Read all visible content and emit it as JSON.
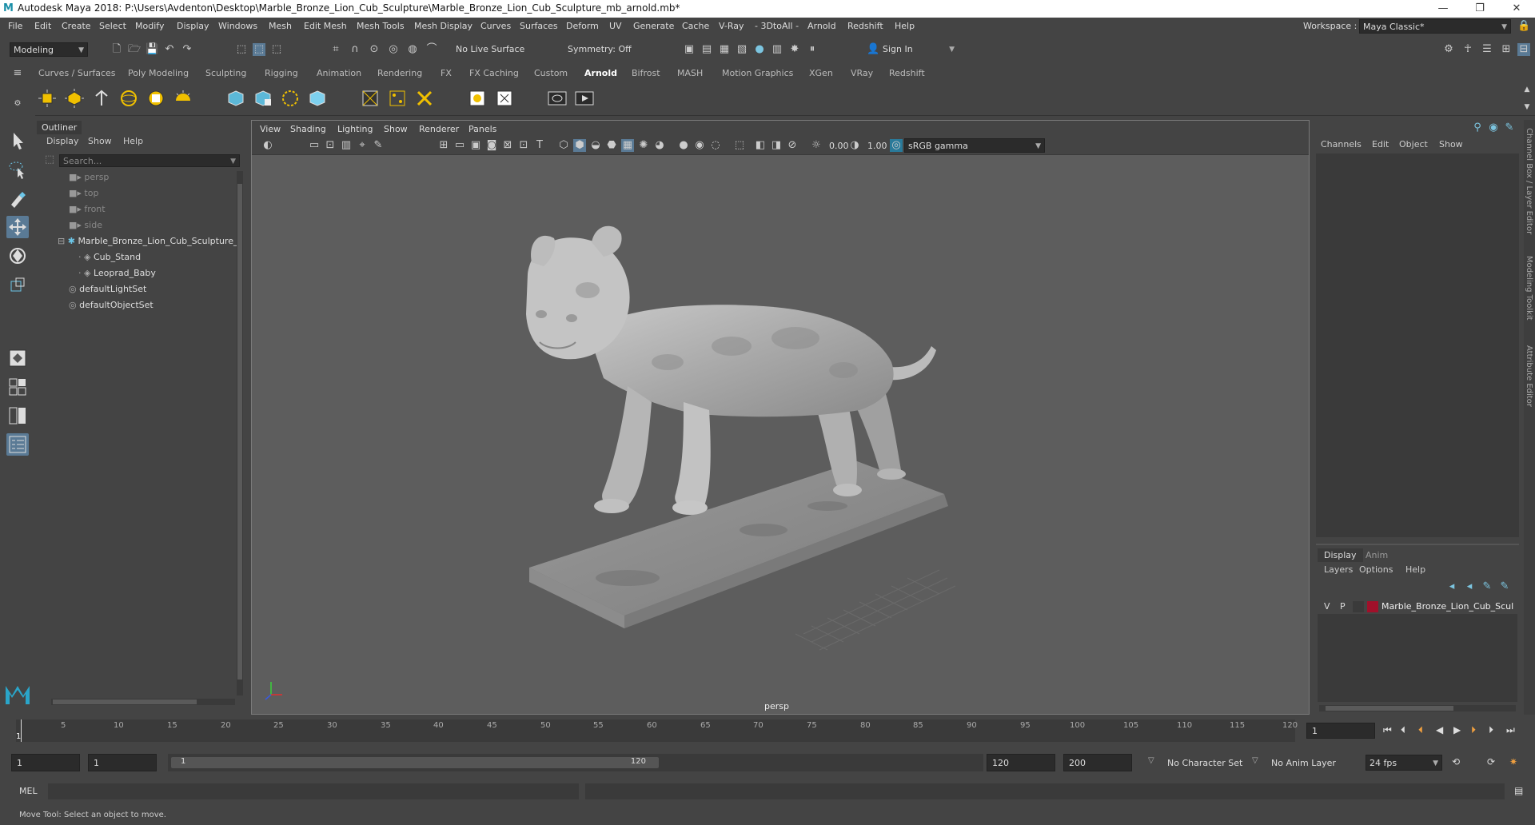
{
  "window": {
    "title": "Autodesk Maya 2018: P:\\Users\\Avdenton\\Desktop\\Marble_Bronze_Lion_Cub_Sculpture\\Marble_Bronze_Lion_Cub_Sculpture_mb_arnold.mb*",
    "logo": "M",
    "minimize": "—",
    "maximize": "❐",
    "close": "✕"
  },
  "menu": [
    "File",
    "Edit",
    "Create",
    "Select",
    "Modify",
    "Display",
    "Windows",
    "Mesh",
    "Edit Mesh",
    "Mesh Tools",
    "Mesh Display",
    "Curves",
    "Surfaces",
    "Deform",
    "UV",
    "Generate",
    "Cache",
    "V-Ray",
    "- 3DtoAll -",
    "Arnold",
    "Redshift",
    "Help"
  ],
  "workspace": {
    "label": "Workspace :",
    "value": "Maya Classic*"
  },
  "toolbar": {
    "mode": "Modeling",
    "live_surface": "No Live Surface",
    "symmetry": "Symmetry: Off",
    "sign_in": "Sign In"
  },
  "shelf_tabs": [
    "Curves / Surfaces",
    "Poly Modeling",
    "Sculpting",
    "Rigging",
    "Animation",
    "Rendering",
    "FX",
    "FX Caching",
    "Custom",
    "Arnold",
    "Bifrost",
    "MASH",
    "Motion Graphics",
    "XGen",
    "VRay",
    "Redshift"
  ],
  "shelf_active": "Arnold",
  "outliner": {
    "tab": "Outliner",
    "menu": [
      "Display",
      "Show",
      "Help"
    ],
    "search_placeholder": "Search...",
    "items": [
      {
        "label": "persp",
        "type": "camera",
        "dim": true
      },
      {
        "label": "top",
        "type": "camera",
        "dim": true
      },
      {
        "label": "front",
        "type": "camera",
        "dim": true
      },
      {
        "label": "side",
        "type": "camera",
        "dim": true
      },
      {
        "label": "Marble_Bronze_Lion_Cub_Sculpture_",
        "type": "group",
        "dim": false
      },
      {
        "label": "Cub_Stand",
        "type": "mesh",
        "dim": false
      },
      {
        "label": "Leoprad_Baby",
        "type": "mesh",
        "dim": false
      },
      {
        "label": "defaultLightSet",
        "type": "set",
        "dim": false
      },
      {
        "label": "defaultObjectSet",
        "type": "set",
        "dim": false
      }
    ]
  },
  "viewport": {
    "menu": [
      "View",
      "Shading",
      "Lighting",
      "Show",
      "Renderer",
      "Panels"
    ],
    "exposure": "0.00",
    "gamma": "1.00",
    "colorspace": "sRGB gamma",
    "camera_label": "persp"
  },
  "channelbox": {
    "menu": [
      "Channels",
      "Edit",
      "Object",
      "Show"
    ],
    "layer_tabs": [
      "Display",
      "Anim"
    ],
    "layer_menu": [
      "Layers",
      "Options",
      "Help"
    ],
    "layer": {
      "v": "V",
      "p": "P",
      "name": "Marble_Bronze_Lion_Cub_Scul",
      "color": "#a0102a"
    }
  },
  "side_tabs": [
    "Channel Box / Layer Editor",
    "Modeling Toolkit",
    "Attribute Editor"
  ],
  "timeline": {
    "ticks": [
      "5",
      "10",
      "15",
      "20",
      "25",
      "30",
      "35",
      "40",
      "45",
      "50",
      "55",
      "60",
      "65",
      "70",
      "75",
      "80",
      "85",
      "90",
      "95",
      "100",
      "105",
      "110",
      "115",
      "120"
    ],
    "current": "1",
    "current_field": "1"
  },
  "range": {
    "start": "1",
    "inner_start": "1",
    "slider_start": "1",
    "slider_end": "120",
    "end": "120",
    "anim_end": "200",
    "character_set": "No Character Set",
    "anim_layer": "No Anim Layer",
    "fps": "24 fps"
  },
  "mel": {
    "label": "MEL"
  },
  "status": {
    "text": "Move Tool: Select an object to move."
  }
}
